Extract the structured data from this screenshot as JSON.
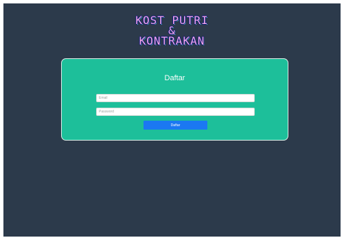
{
  "header": {
    "line1": "KOST PUTRI",
    "line2": "&",
    "line3": "KONTRAKAN"
  },
  "form": {
    "title": "Daftar",
    "email_placeholder": "Email",
    "password_placeholder": "Password",
    "submit_label": "Daftar"
  },
  "colors": {
    "background": "#2c3a4b",
    "card": "#1dbf9a",
    "button": "#1b78f2"
  }
}
